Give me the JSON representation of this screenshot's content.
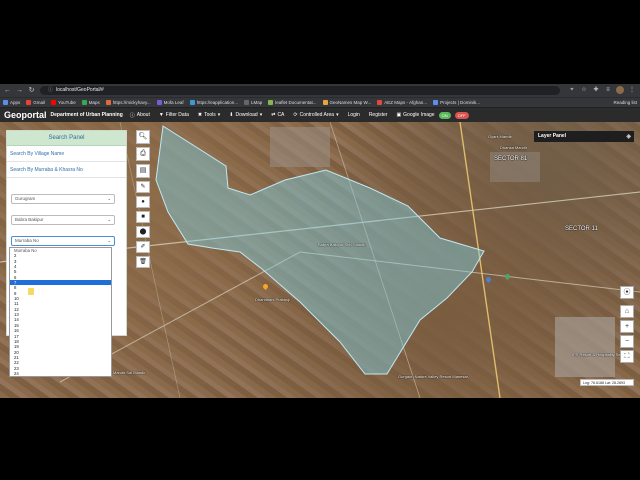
{
  "browser": {
    "url": "localhost/GeoPortal/#",
    "bookmarks": [
      {
        "label": "Apps",
        "color": "#5b8def"
      },
      {
        "label": "Gmail",
        "color": "#ea4335"
      },
      {
        "label": "YouTube",
        "color": "#ff0000"
      },
      {
        "label": "Maps",
        "color": "#34a853"
      },
      {
        "label": "https://mickyhavy...",
        "color": "#e06b3a"
      },
      {
        "label": "Mofa Leaf",
        "color": "#7b5bd6"
      },
      {
        "label": "https://eapplication...",
        "color": "#3a9ad9"
      },
      {
        "label": "LMap",
        "color": "#666666"
      },
      {
        "label": "leaflet Documentat...",
        "color": "#83b84a"
      },
      {
        "label": "GeoNames Map W...",
        "color": "#e8a53a"
      },
      {
        "label": "AEZ Maps - Afghan...",
        "color": "#e0483a"
      },
      {
        "label": "Projects | Dominik...",
        "color": "#5b8def"
      }
    ],
    "reading_list": "Reading list"
  },
  "navbar": {
    "brand": "Geoportal",
    "department": "Department of Urban Planning",
    "items": [
      {
        "label": "About",
        "icon": "info-icon",
        "glyph": "ⓘ"
      },
      {
        "label": "Filter Data",
        "icon": "filter-icon",
        "glyph": "▼"
      },
      {
        "label": "Tools",
        "icon": "tools-icon",
        "glyph": "✖"
      },
      {
        "label": "Download",
        "icon": "download-icon",
        "glyph": "⬇"
      },
      {
        "label": "CA",
        "icon": "ca-icon",
        "glyph": "⇄"
      },
      {
        "label": "Controlled Area",
        "icon": "area-icon",
        "glyph": "⟳"
      },
      {
        "label": "Login",
        "icon": "",
        "glyph": ""
      },
      {
        "label": "Register",
        "icon": "",
        "glyph": ""
      }
    ],
    "google_image": "Google Image",
    "toggle_on": "ON",
    "toggle_off": "OFF"
  },
  "search_panel": {
    "title": "Search Panel",
    "link_village": "Search By Village Name",
    "link_murraba": "Search By Murraba & Khasra No",
    "district": "Gurugram",
    "village": "Babra Bakipur",
    "murraba_placeholder": "Murraba No",
    "options": [
      "Murraba No",
      "2",
      "3",
      "4",
      "5",
      "6",
      "7",
      "8",
      "9",
      "10",
      "11",
      "12",
      "13",
      "14",
      "15",
      "16",
      "17",
      "18",
      "19",
      "20",
      "21",
      "22",
      "23",
      "24"
    ],
    "highlighted_option": "7"
  },
  "layer_panel": {
    "title": "Layer Panel"
  },
  "map": {
    "labels": [
      "Gyani Mandir",
      "Dhanka Mandir",
      "SECTOR 81",
      "SECTOR 11",
      "Babra Bakipur Shiv Mandir",
      "Dhandhani Prabhuji",
      "Mandir Sai Mandir",
      "Gurgaon Nature Valley Resort Manesar",
      "IPS Resort & Hospitality Service"
    ],
    "coords": "Lng: 76.6188 Lat: 28.2893",
    "polygon_fill": "#7fd3e6"
  }
}
